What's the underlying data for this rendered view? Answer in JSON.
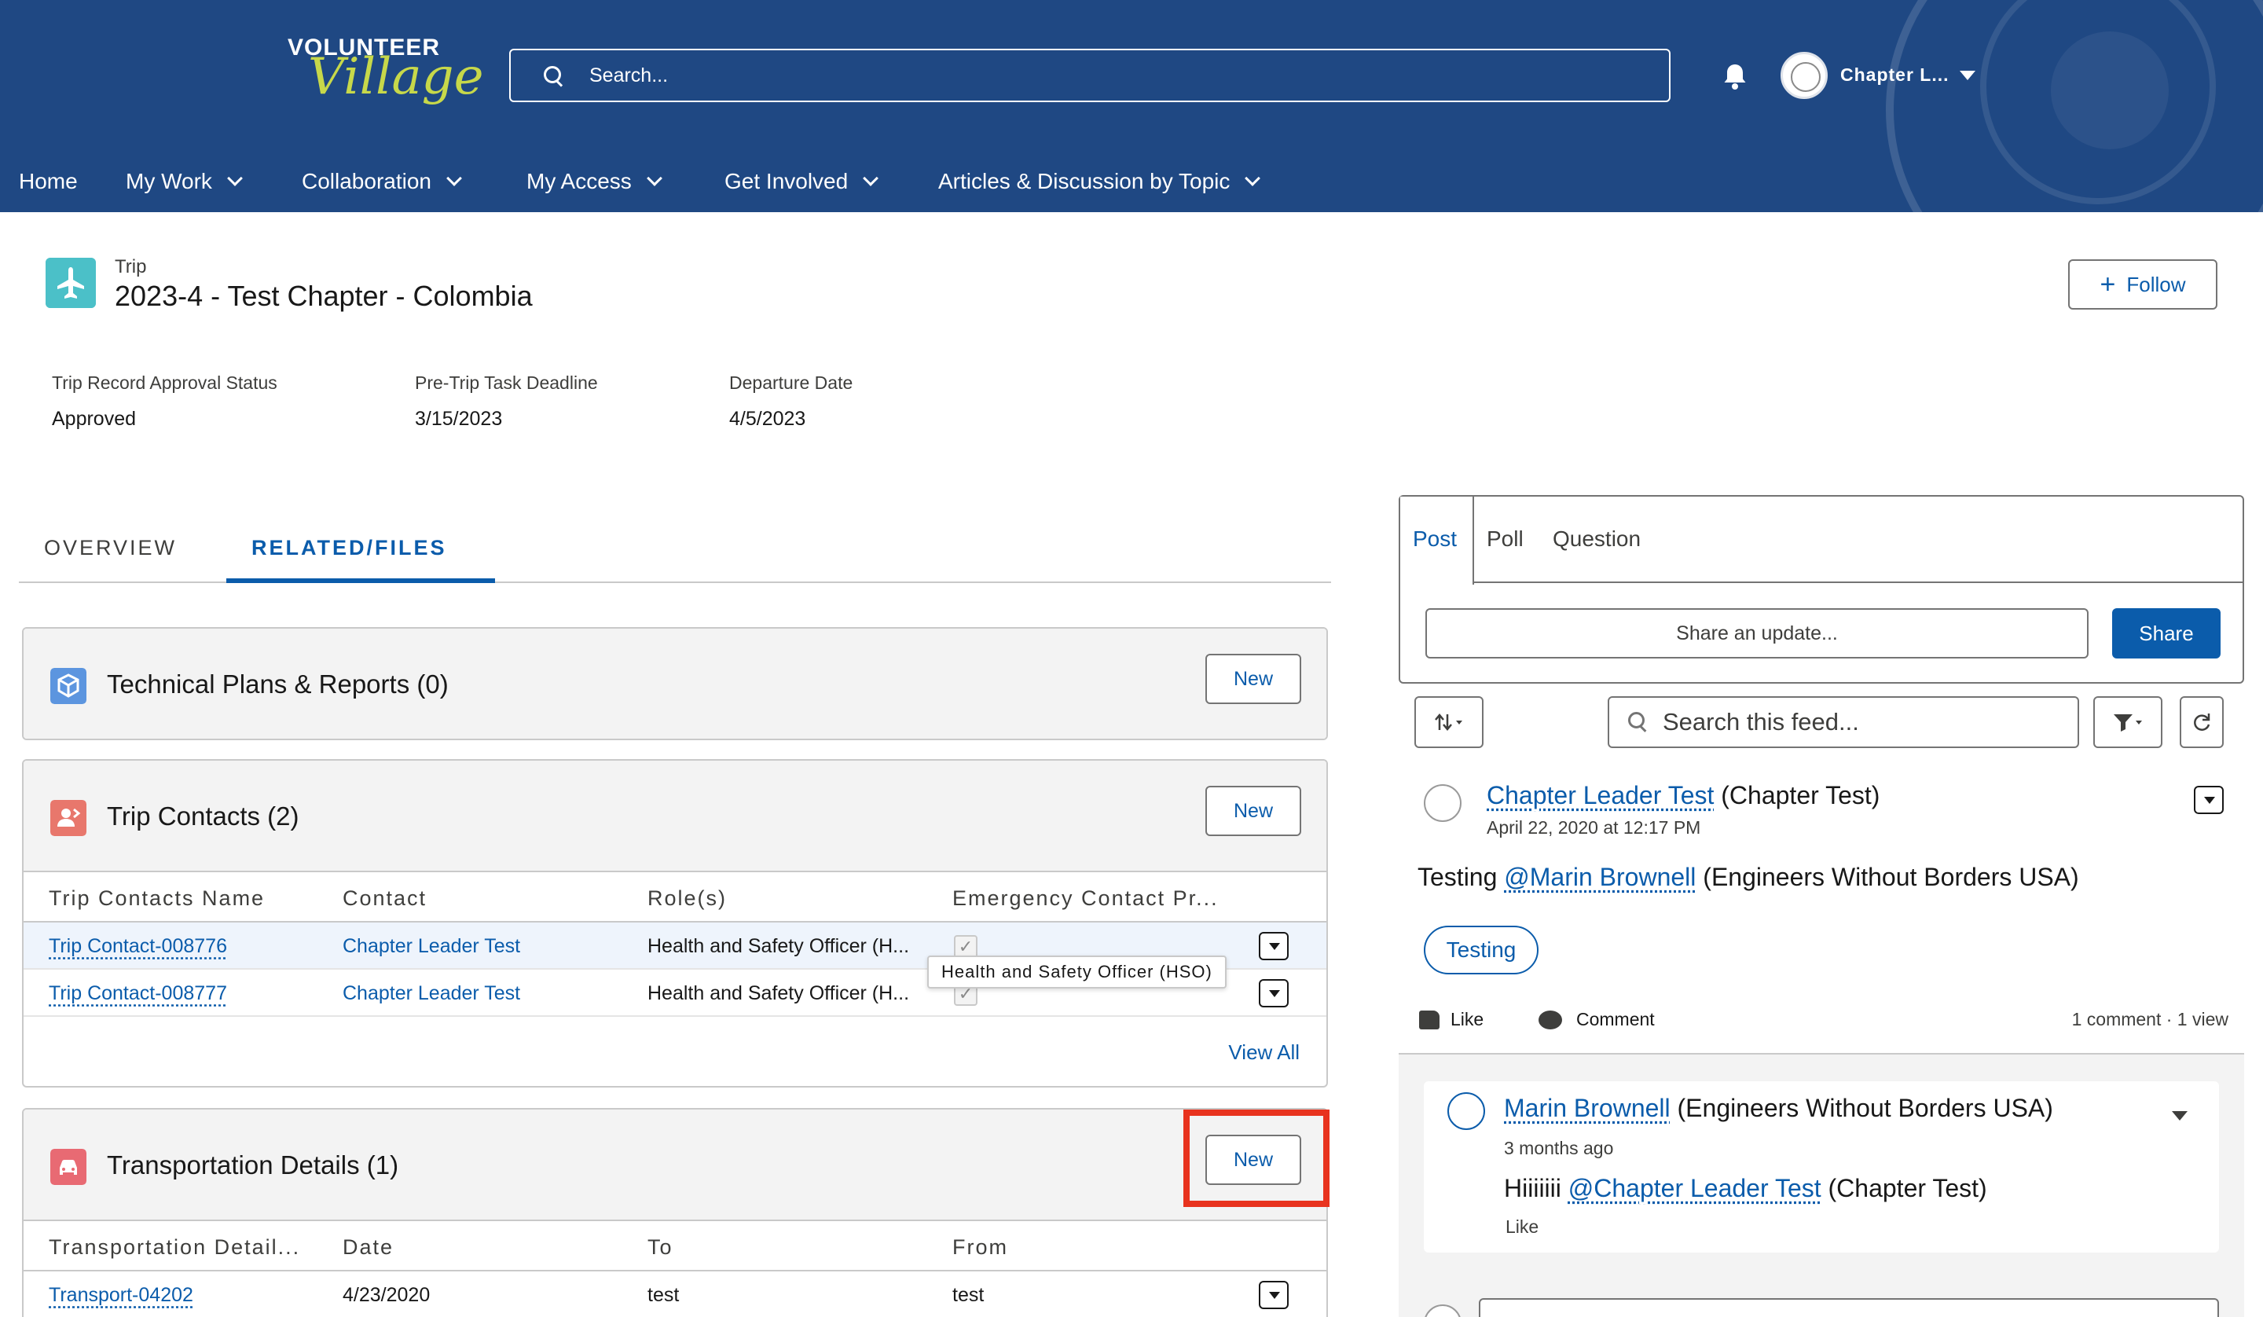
{
  "header": {
    "logo_top": "VOLUNTEER",
    "logo_script": "Village",
    "search_placeholder": "Search...",
    "user_label": "Chapter L...",
    "colors": {
      "bar": "#1f4883",
      "logo_accent": "#c7d84a"
    }
  },
  "nav": {
    "items": [
      {
        "label": "Home",
        "has_menu": false
      },
      {
        "label": "My Work",
        "has_menu": true
      },
      {
        "label": "Collaboration",
        "has_menu": true
      },
      {
        "label": "My Access",
        "has_menu": true
      },
      {
        "label": "Get Involved",
        "has_menu": true
      },
      {
        "label": "Articles & Discussion by Topic",
        "has_menu": true
      }
    ]
  },
  "record": {
    "type_label": "Trip",
    "title": "2023-4 - Test Chapter - Colombia",
    "follow_label": "Follow",
    "fields": [
      {
        "label": "Trip Record Approval Status",
        "value": "Approved"
      },
      {
        "label": "Pre-Trip Task Deadline",
        "value": "3/15/2023"
      },
      {
        "label": "Departure Date",
        "value": "4/5/2023"
      }
    ]
  },
  "tabs": [
    {
      "label": "OVERVIEW",
      "active": false
    },
    {
      "label": "RELATED/FILES",
      "active": true
    }
  ],
  "related": {
    "technical": {
      "title": "Technical Plans & Reports (0)",
      "new_label": "New",
      "icon": "cube-icon",
      "icon_color": "#5c95df"
    },
    "contacts": {
      "title": "Trip Contacts (2)",
      "new_label": "New",
      "icon": "contact-icon",
      "icon_color": "#e8776c",
      "columns": [
        "Trip Contacts Name",
        "Contact",
        "Role(s)",
        "Emergency Contact Pr..."
      ],
      "rows": [
        {
          "name": "Trip Contact-008776",
          "contact": "Chapter Leader Test",
          "role": "Health and Safety Officer (H...",
          "emergency": true
        },
        {
          "name": "Trip Contact-008777",
          "contact": "Chapter Leader Test",
          "role": "Health and Safety Officer (H...",
          "emergency": true
        }
      ],
      "view_all": "View All",
      "tooltip": "Health and Safety Officer (HSO)"
    },
    "transport": {
      "title": "Transportation Details (1)",
      "new_label": "New",
      "icon": "car-icon",
      "icon_color": "#e86a73",
      "columns": [
        "Transportation Detail...",
        "Date",
        "To",
        "From"
      ],
      "rows": [
        {
          "name": "Transport-04202",
          "date": "4/23/2020",
          "to": "test",
          "from": "test"
        }
      ],
      "highlight_color": "#e8331e"
    }
  },
  "chatter": {
    "publisher_tabs": [
      {
        "label": "Post",
        "active": true
      },
      {
        "label": "Poll",
        "active": false
      },
      {
        "label": "Question",
        "active": false
      }
    ],
    "share_placeholder": "Share an update...",
    "share_label": "Share",
    "feed_search_placeholder": "Search this feed...",
    "post": {
      "author": "Chapter Leader Test",
      "author_org": "(Chapter Test)",
      "date": "April 22, 2020 at 12:17 PM",
      "body_prefix": "Testing",
      "mention": "@Marin Brownell",
      "mention_org": "(Engineers Without Borders USA)",
      "topic": "Testing",
      "like_label": "Like",
      "comment_label": "Comment",
      "stats": "1 comment  ·  1 view"
    },
    "comment": {
      "author": "Marin Brownell",
      "author_org": "(Engineers Without Borders USA)",
      "date": "3 months ago",
      "body_prefix": "Hiiiiiii",
      "mention": "@Chapter Leader Test",
      "mention_org": "(Chapter Test)",
      "like_label": "Like"
    }
  }
}
